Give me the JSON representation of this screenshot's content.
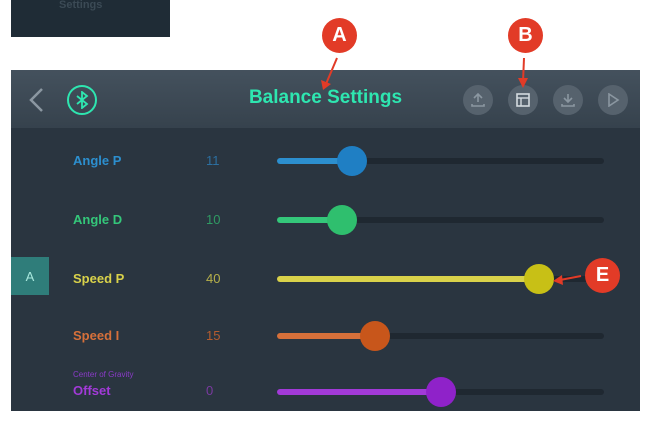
{
  "thumbnail": {
    "text": "Settings"
  },
  "header": {
    "title": "Balance Settings",
    "back_icon": "chevron-left-icon",
    "bluetooth_icon": "bluetooth-icon",
    "buttons": [
      "upload-icon",
      "document-icon",
      "download-icon",
      "play-icon"
    ]
  },
  "side_tab": {
    "label": "A"
  },
  "sliders": [
    {
      "label": "Angle P",
      "value": "11",
      "level": 0.23,
      "color": "#2c8fcf",
      "knob": "#1f7fc4"
    },
    {
      "label": "Angle D",
      "value": "10",
      "level": 0.2,
      "color": "#34c77a",
      "knob": "#2fbf6e"
    },
    {
      "label": "Speed P",
      "value": "40",
      "level": 0.8,
      "color": "#d9d24a",
      "knob": "#c8c016"
    },
    {
      "label": "Speed I",
      "value": "15",
      "level": 0.3,
      "color": "#d6703a",
      "knob": "#c8561b"
    },
    {
      "sublabel": "Center of Gravity",
      "label": "Offset",
      "value": "0",
      "level": 0.5,
      "color": "#a23ad8",
      "knob": "#8f22c9"
    }
  ],
  "annotations": [
    "A",
    "B",
    "E"
  ],
  "colors": {
    "accent": "#2ee6b0",
    "annotation": "#e23b27"
  }
}
